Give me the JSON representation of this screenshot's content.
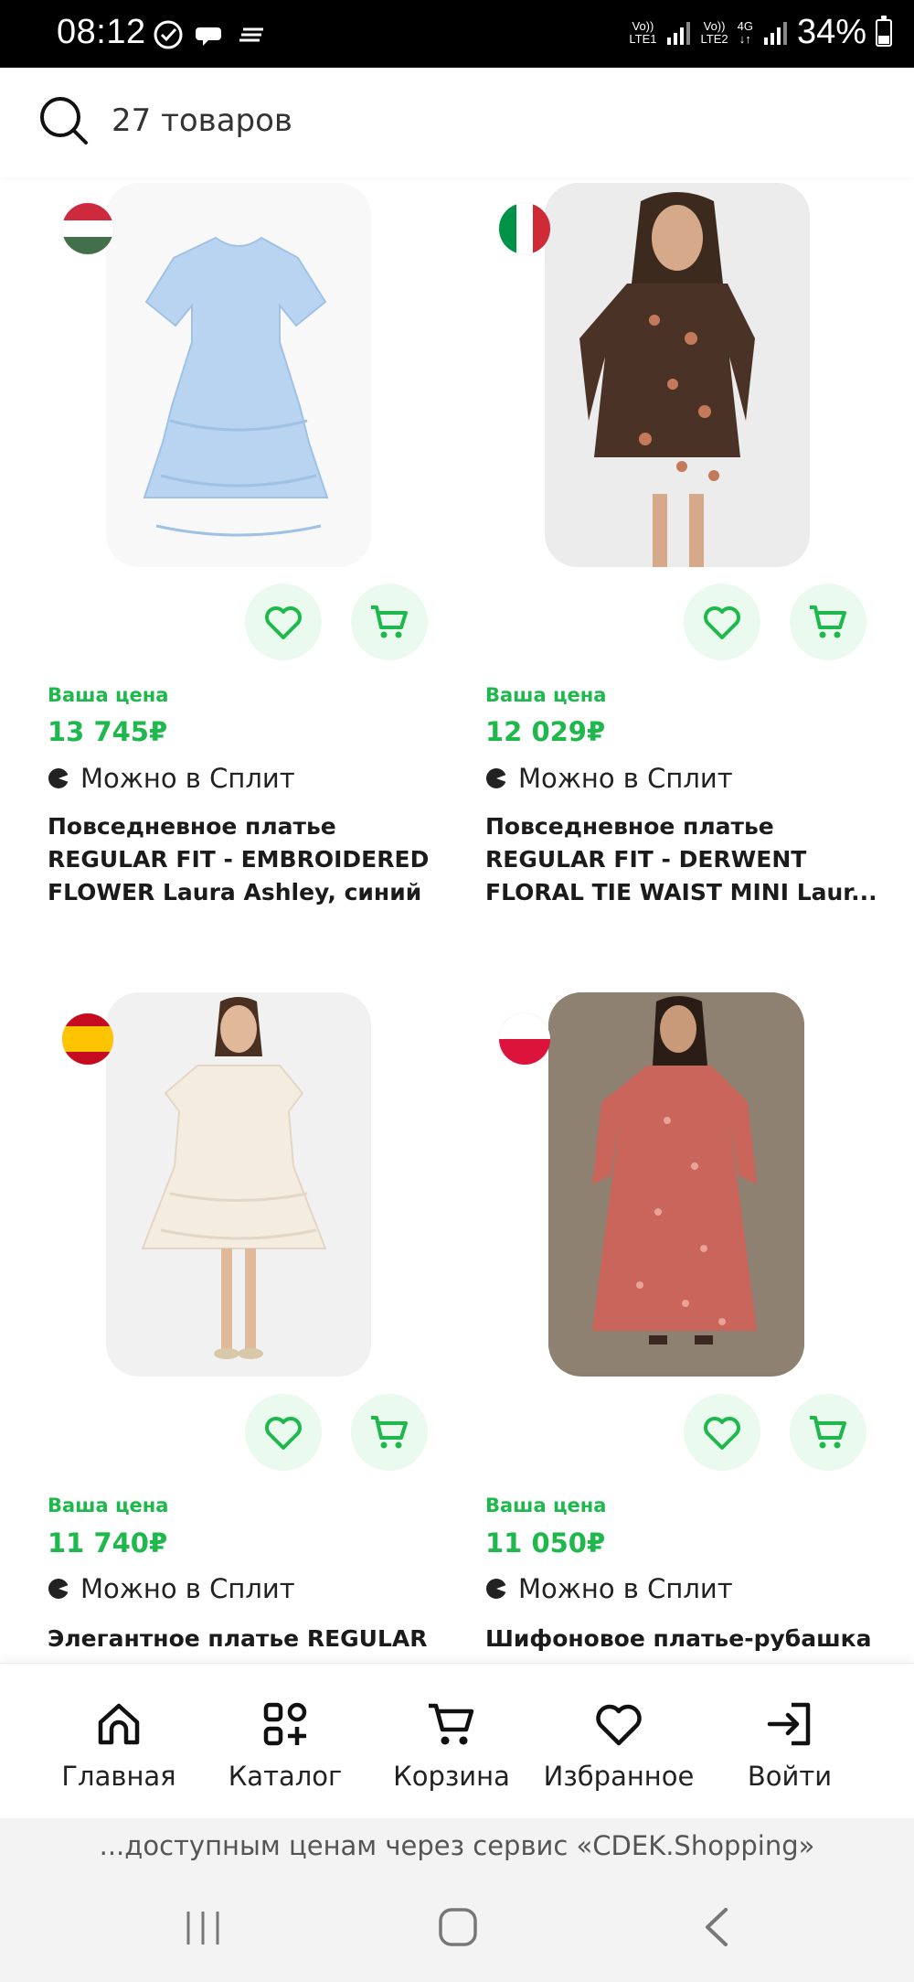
{
  "status_bar": {
    "time": "08:12",
    "net1_line1": "Vo))",
    "net1_line2": "LTE1",
    "net2_line1": "Vo))",
    "net2_line2": "LTE2",
    "network_type": "4G",
    "battery": "34%"
  },
  "search": {
    "count_text": "27 товаров"
  },
  "products": [
    {
      "price_label": "Ваша цена",
      "price": "13 745₽",
      "split_text": "Можно в Сплит",
      "title": "Повседневное платье REGULAR FIT - EMBROIDERED FLOWER Laura Ashley, синий",
      "flag": "hungary"
    },
    {
      "price_label": "Ваша цена",
      "price": "12 029₽",
      "split_text": "Можно в Сплит",
      "title": "Повседневное платье REGULAR FIT - DERWENT FLORAL TIE WAIST MINI Laur...",
      "flag": "italy"
    },
    {
      "price_label": "Ваша цена",
      "price": "11 740₽",
      "split_text": "Можно в Сплит",
      "title": "Элегантное платье REGULAR",
      "flag": "spain"
    },
    {
      "price_label": "Ваша цена",
      "price": "11 050₽",
      "split_text": "Можно в Сплит",
      "title": "Шифоновое платье-рубашка",
      "flag": "poland"
    }
  ],
  "bottom_nav": [
    {
      "label": "Главная",
      "icon": "home-icon"
    },
    {
      "label": "Каталог",
      "icon": "catalog-icon"
    },
    {
      "label": "Корзина",
      "icon": "cart-icon"
    },
    {
      "label": "Избранное",
      "icon": "heart-icon"
    },
    {
      "label": "Войти",
      "icon": "login-icon"
    }
  ],
  "banner": {
    "text": "...доступным ценам через сервис «CDEK.Shopping»"
  },
  "colors": {
    "accent": "#1eb84d",
    "accent_bg": "#eafaee"
  }
}
